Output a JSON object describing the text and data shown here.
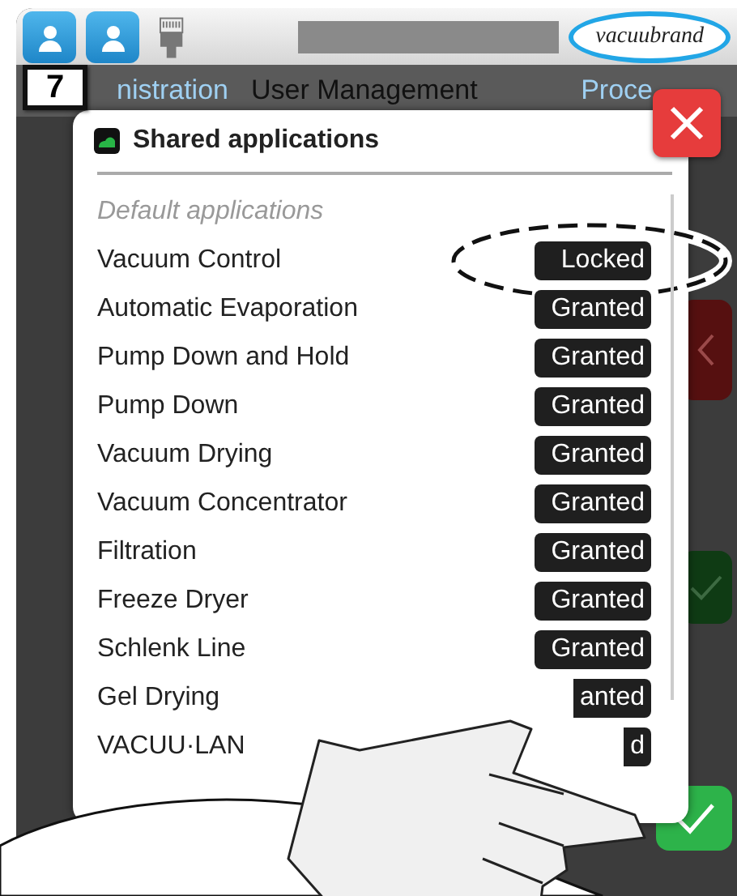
{
  "header": {
    "logo": "vacuubrand"
  },
  "callout": {
    "label": "7"
  },
  "tabs": [
    {
      "label": "nistration",
      "selected": false
    },
    {
      "label": "User Management",
      "selected": true
    },
    {
      "label": "Proce",
      "selected": false
    }
  ],
  "dialog": {
    "title": "Shared applications",
    "section": "Default applications",
    "rows": [
      {
        "name": "Vacuum Control",
        "status": "Locked",
        "highlighted": true
      },
      {
        "name": "Automatic Evaporation",
        "status": "Granted",
        "highlighted": false
      },
      {
        "name": "Pump Down and Hold",
        "status": "Granted",
        "highlighted": false
      },
      {
        "name": "Pump Down",
        "status": "Granted",
        "highlighted": false
      },
      {
        "name": "Vacuum Drying",
        "status": "Granted",
        "highlighted": false
      },
      {
        "name": "Vacuum Concentrator",
        "status": "Granted",
        "highlighted": false
      },
      {
        "name": "Filtration",
        "status": "Granted",
        "highlighted": false
      },
      {
        "name": "Freeze Dryer",
        "status": "Granted",
        "highlighted": false
      },
      {
        "name": "Schlenk Line",
        "status": "Granted",
        "highlighted": false
      },
      {
        "name": "Gel Drying",
        "status": "anted",
        "highlighted": false,
        "cut": true
      },
      {
        "name": "VACUU·LAN",
        "status": "d",
        "highlighted": false,
        "cut": true
      }
    ]
  }
}
